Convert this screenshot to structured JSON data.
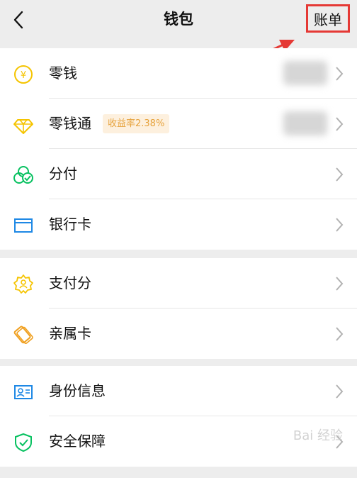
{
  "header": {
    "back_icon": "chevron-left-icon",
    "title": "钱包",
    "bill_label": "账单",
    "highlight_color": "#e53935"
  },
  "sections": [
    {
      "items": [
        {
          "label": "零钱",
          "icon": "yuan-coin-icon",
          "value": "hidden"
        },
        {
          "label": "零钱通",
          "icon": "diamond-icon",
          "badge": "收益率2.38%",
          "value": "hidden"
        },
        {
          "label": "分付",
          "icon": "fenfu-icon"
        },
        {
          "label": "银行卡",
          "icon": "bank-card-icon"
        }
      ]
    },
    {
      "items": [
        {
          "label": "支付分",
          "icon": "payment-score-icon"
        },
        {
          "label": "亲属卡",
          "icon": "family-card-icon"
        }
      ]
    },
    {
      "items": [
        {
          "label": "身份信息",
          "icon": "id-card-icon"
        },
        {
          "label": "安全保障",
          "icon": "shield-check-icon"
        }
      ]
    }
  ],
  "watermark": "Bai 经验"
}
